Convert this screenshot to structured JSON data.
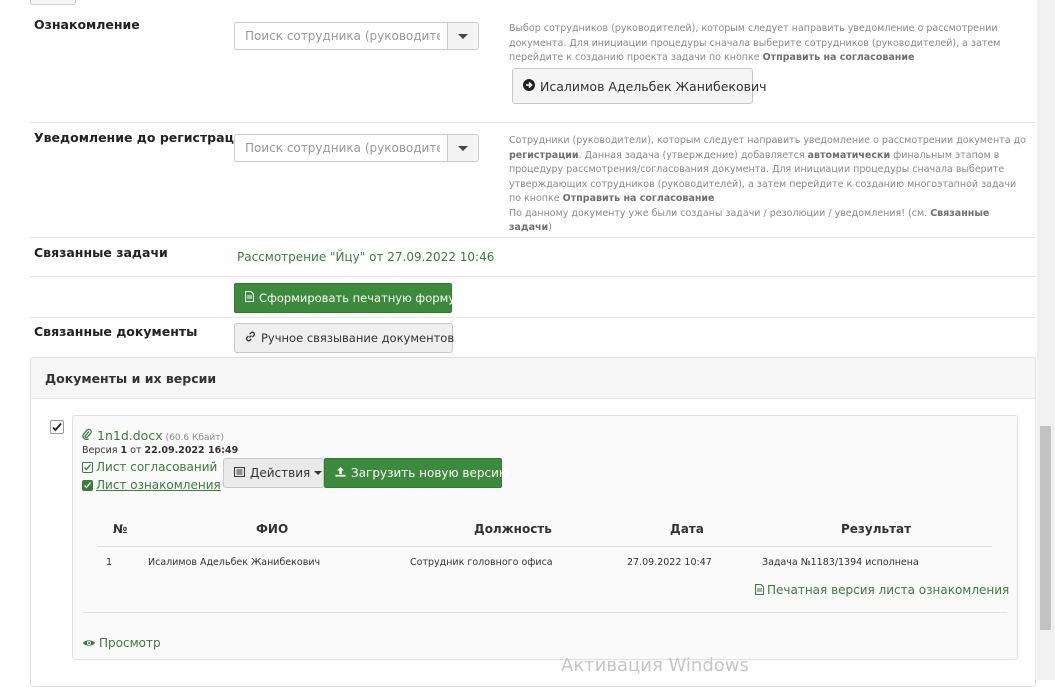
{
  "rows": {
    "familiarization": {
      "label": "Ознакомление",
      "search_placeholder": "Поиск сотрудника (руководителя)",
      "hint_text": "Выбор сотрудников (руководителей), которым следует направить уведомление о рассмотрении документа. Для инициации процедуры сначала выберите сотрудников (руководителей), а затем перейдите к созданию проекта задачи по кнопке ",
      "hint_bold": "Отправить на согласование",
      "employee_button": "Исалимов Адельбек Жанибекович"
    },
    "pre_registration": {
      "label": "Уведомление до регистрации",
      "search_placeholder": "Поиск сотрудника (руководителя)",
      "hint_p1": "Сотрудники (руководители), которым следует направить уведомление о рассмотрении документа до ",
      "hint_b1": "регистрации",
      "hint_p2": ". Данная задача (утверждение) добавляется ",
      "hint_b2": "автоматически",
      "hint_p3": " финальным этапом в процедуру рассмотрения/согласования документа. Для инициации процедуры сначала выберите утверждающих сотрудников (руководителей), а затем перейдите к созданию многоэтапной задачи по кнопке ",
      "hint_b3": "Отправить на согласование",
      "hint_p4": "По данному документу уже были созданы задачи / резолюции / уведомления! (см. ",
      "hint_b4": "Связанные задачи",
      "hint_p5": ")"
    },
    "related_tasks": {
      "label": "Связанные задачи",
      "task_link": "Рассмотрение \"Йцу\" от 27.09.2022 10:46",
      "print_button": "Сформировать печатную форму"
    },
    "related_docs": {
      "label": "Связанные документы",
      "manual_link_button": "Ручное связывание документов"
    }
  },
  "documents": {
    "title": "Документы и их версии",
    "file": {
      "name": "1n1d.docx",
      "size": "(60.6 Кбайт)",
      "version_prefix": "Версия ",
      "version_num": "1",
      "version_mid": " от ",
      "version_date": "22.09.2022 16:49",
      "approvals_sheet": "Лист согласований",
      "familiarization_sheet": "Лист ознакомления",
      "actions_button": "Действия",
      "upload_button": "Загрузить новую версию"
    },
    "table": {
      "headers": [
        "№",
        "ФИО",
        "Должность",
        "Дата",
        "Результат"
      ],
      "row": {
        "num": "1",
        "name": "Исалимов Адельбек Жанибекович",
        "position": "Сотрудник головного офиса",
        "date": "27.09.2022 10:47",
        "result": "Задача №1183/1394 исполнена"
      },
      "print_version_link": "Печатная версия листа ознакомления"
    },
    "view_link": "Просмотр"
  },
  "watermark": "Активация Windows",
  "colors": {
    "accent_green": "#3c8b3c",
    "link_green": "#3a7d3a"
  },
  "icons": [
    "arrow-circle-right-icon",
    "file-icon",
    "link-icon",
    "paperclip-icon",
    "list-icon",
    "upload-icon",
    "eye-icon",
    "check-icon",
    "caret-down-icon"
  ]
}
